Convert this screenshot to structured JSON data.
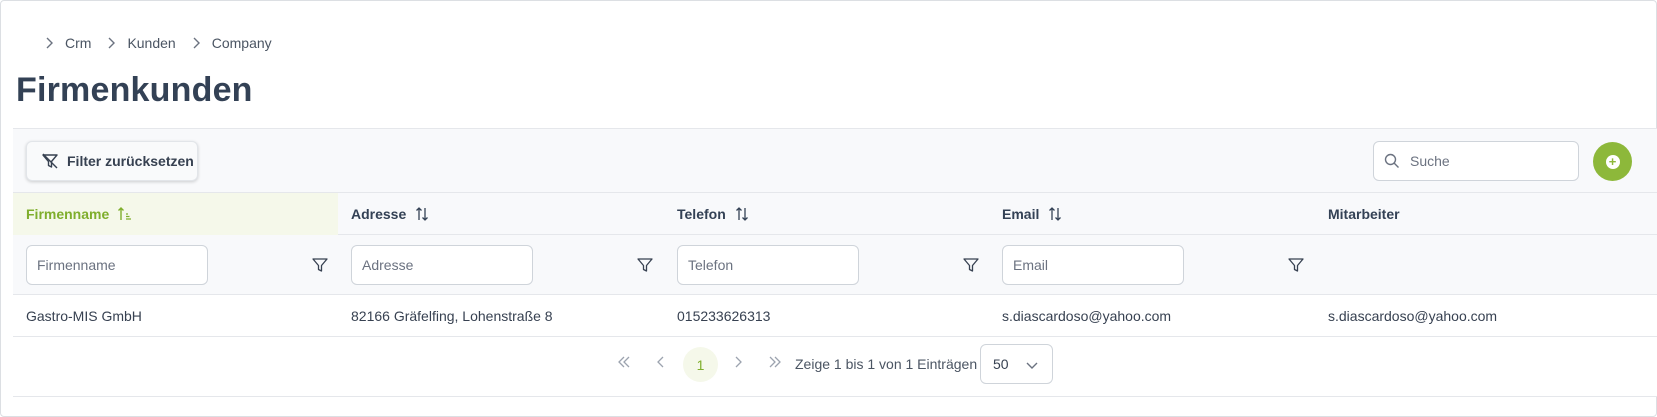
{
  "breadcrumb": [
    "Crm",
    "Kunden",
    "Company"
  ],
  "page": {
    "title": "Firmenkunden"
  },
  "toolbar": {
    "reset_filter_label": "Filter zurücksetzen",
    "search_placeholder": "Suche",
    "add_icon": "plus-circle-icon"
  },
  "table": {
    "columns": [
      {
        "label": "Firmenname",
        "sorted": "ascending",
        "filter_placeholder": "Firmenname"
      },
      {
        "label": "Adresse",
        "sorted": "none",
        "filter_placeholder": "Adresse"
      },
      {
        "label": "Telefon",
        "sorted": "none",
        "filter_placeholder": "Telefon"
      },
      {
        "label": "Email",
        "sorted": "none",
        "filter_placeholder": "Email"
      },
      {
        "label": "Mitarbeiter"
      }
    ],
    "rows": [
      [
        "Gastro-MIS GmbH",
        "82166 Gräfelfing, Lohenstraße 8",
        "015233626313",
        "s.diascardoso@yahoo.com",
        "s.diascardoso@yahoo.com"
      ]
    ]
  },
  "pagination": {
    "current_page": "1",
    "info": "Zeige 1 bis 1 von 1 Einträgen",
    "page_size": "50"
  },
  "colors": {
    "accent": "#8db83a",
    "accent_text": "#7fae2c",
    "active_header_bg": "#f5f8ea",
    "title_text": "#334155"
  }
}
